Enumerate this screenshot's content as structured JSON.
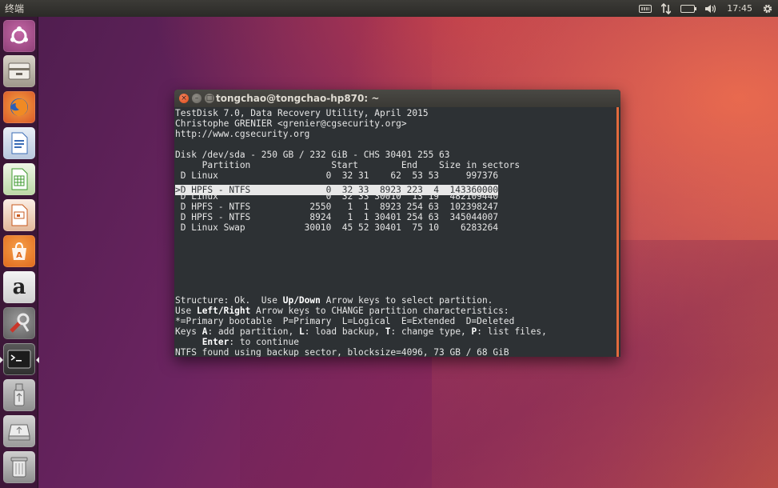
{
  "top_panel": {
    "app_title": "终端",
    "clock": "17:45",
    "indicators": [
      "keyboard-icon",
      "network-icon",
      "battery-icon",
      "volume-icon",
      "gear-icon"
    ]
  },
  "launcher": {
    "items": [
      "ubuntu-dash-icon",
      "files-icon",
      "firefox-icon",
      "writer-icon",
      "calc-icon",
      "impress-icon",
      "software-center-icon",
      "amazon-icon",
      "system-settings-icon",
      "terminal-icon",
      "usb-drive-icon",
      "removable-drive-icon",
      "trash-icon"
    ]
  },
  "window": {
    "title": "tongchao@tongchao-hp870: ~"
  },
  "terminal": {
    "header": [
      "TestDisk 7.0, Data Recovery Utility, April 2015",
      "Christophe GRENIER <grenier@cgsecurity.org>",
      "http://www.cgsecurity.org"
    ],
    "disk_line": "Disk /dev/sda - 250 GB / 232 GiB - CHS 30401 255 63",
    "column_header": "     Partition               Start        End    Size in sectors",
    "rows": [
      " D Linux                    0  32 31    62  53 53     997376",
      ">D HPFS - NTFS              0  32 33  8923 223  4  143360000",
      " D Linux                    0  32 33 30010  13 19  482109440",
      " D HPFS - NTFS           2550   1  1  8923 254 63  102398247",
      " D HPFS - NTFS           8924   1  1 30401 254 63  345044007",
      " D Linux Swap           30010  45 52 30401  75 10    6283264"
    ],
    "selected_row": 1,
    "footer": {
      "structure_pre": "Structure: Ok.  Use ",
      "up_down": "Up/Down",
      "structure_post": " Arrow keys to select partition.",
      "use_pre": "Use ",
      "left_right": "Left/Right",
      "use_post": " Arrow keys to CHANGE partition characteristics:",
      "legend": "*=Primary bootable  P=Primary  L=Logical  E=Extended  D=Deleted",
      "keys_pre": "Keys ",
      "key_a": "A",
      "keys_a_text": ": add partition, ",
      "key_l": "L",
      "keys_l_text": ": load backup, ",
      "key_t": "T",
      "keys_t_text": ": change type, ",
      "key_p": "P",
      "keys_p_text": ": list files,",
      "enter_indent": "     ",
      "enter_key": "Enter",
      "enter_text": ": to continue",
      "status": "NTFS found using backup sector, blocksize=4096, 73 GB / 68 GiB"
    }
  }
}
